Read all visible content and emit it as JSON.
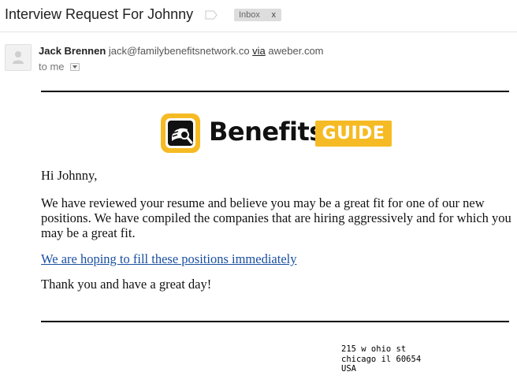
{
  "header": {
    "subject": "Interview Request For Johnny",
    "label_icon": "label-icon",
    "inbox_label": "Inbox",
    "remove_label": "x"
  },
  "sender": {
    "avatar_icon": "person-avatar-icon",
    "name": "Jack Brennen",
    "email": "jack@familybenefitsnetwork.co",
    "via_label": "via",
    "via_domain": "aweber.com",
    "to": "to me",
    "toggle_icon": "chevron-down-icon"
  },
  "email": {
    "logo": {
      "icon": "book-magnifier-icon",
      "word": "Benefits",
      "badge": "GUIDE",
      "badge_color": "#f6bb24"
    },
    "greeting": "Hi Johnny,",
    "paragraph": "We have reviewed your resume and believe you may be a great fit for one of our new positions.  We have compiled the companies that are hiring aggressively and for which you may be a great fit.",
    "cta_link": "We are hoping to fill these positions immediately",
    "signoff": "Thank you and have a great day!",
    "link_color": "#1a4fa0"
  },
  "footer": {
    "address": [
      "215 w ohio st",
      "chicago il 60654",
      "USA"
    ]
  }
}
